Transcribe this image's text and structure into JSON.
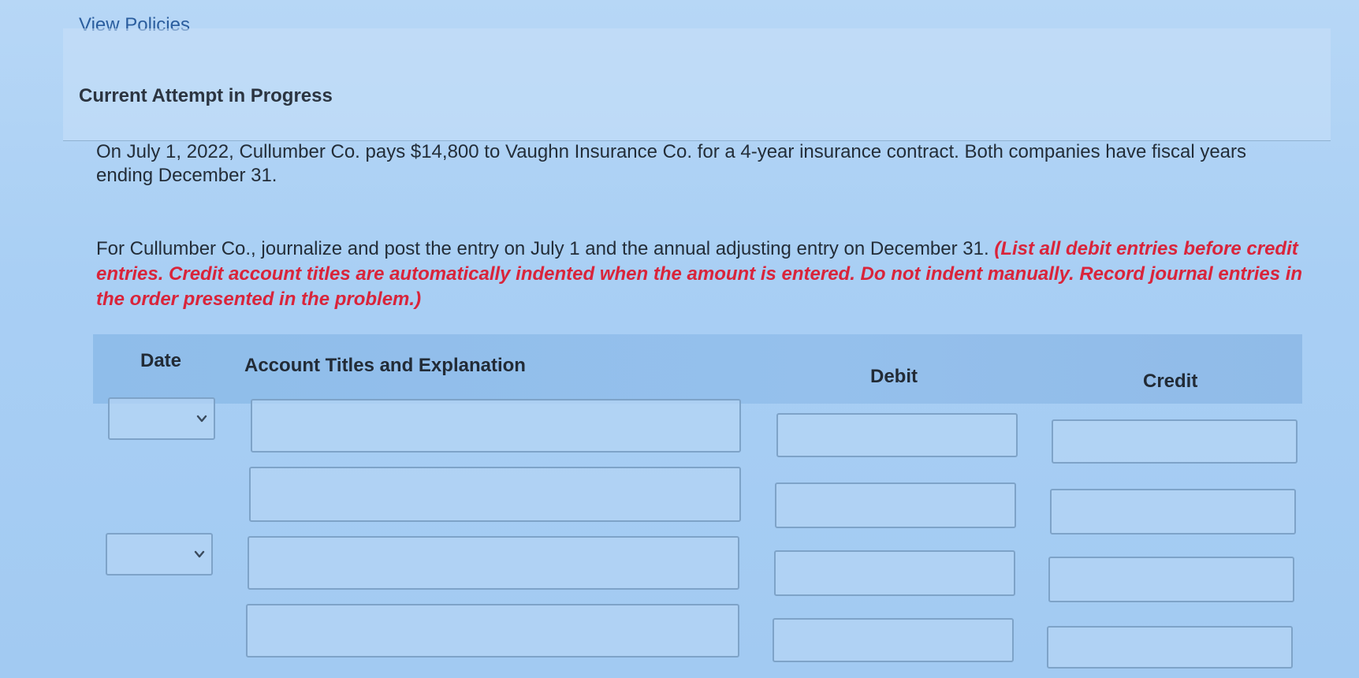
{
  "header": {
    "view_policies_label": "View Policies",
    "attempt_heading": "Current Attempt in Progress"
  },
  "problem": {
    "text": "On July 1, 2022, Cullumber Co. pays $14,800 to Vaughn Insurance Co. for a 4-year insurance contract. Both companies have fiscal years ending December 31.",
    "instruction": "For Cullumber Co., journalize and post the entry on July 1 and the annual adjusting entry on December 31.",
    "instruction_note": "(List all debit entries before credit entries. Credit account titles are automatically indented when the amount is entered. Do not indent manually. Record journal entries in the order presented in the problem.)"
  },
  "journal_table": {
    "columns": {
      "date": "Date",
      "account": "Account Titles and Explanation",
      "debit": "Debit",
      "credit": "Credit"
    },
    "entries": [
      {
        "date_value": "",
        "rows": [
          {
            "account": "",
            "debit": "",
            "credit": ""
          },
          {
            "account": "",
            "debit": "",
            "credit": ""
          }
        ]
      },
      {
        "date_value": "",
        "rows": [
          {
            "account": "",
            "debit": "",
            "credit": ""
          },
          {
            "account": "",
            "debit": "",
            "credit": ""
          }
        ]
      }
    ]
  },
  "icons": {
    "date_dropdown": "chevron-down-icon"
  },
  "colors": {
    "instruction_note": "#d9243a",
    "link": "#2a5d9e",
    "table_header": "#8fbdea"
  }
}
